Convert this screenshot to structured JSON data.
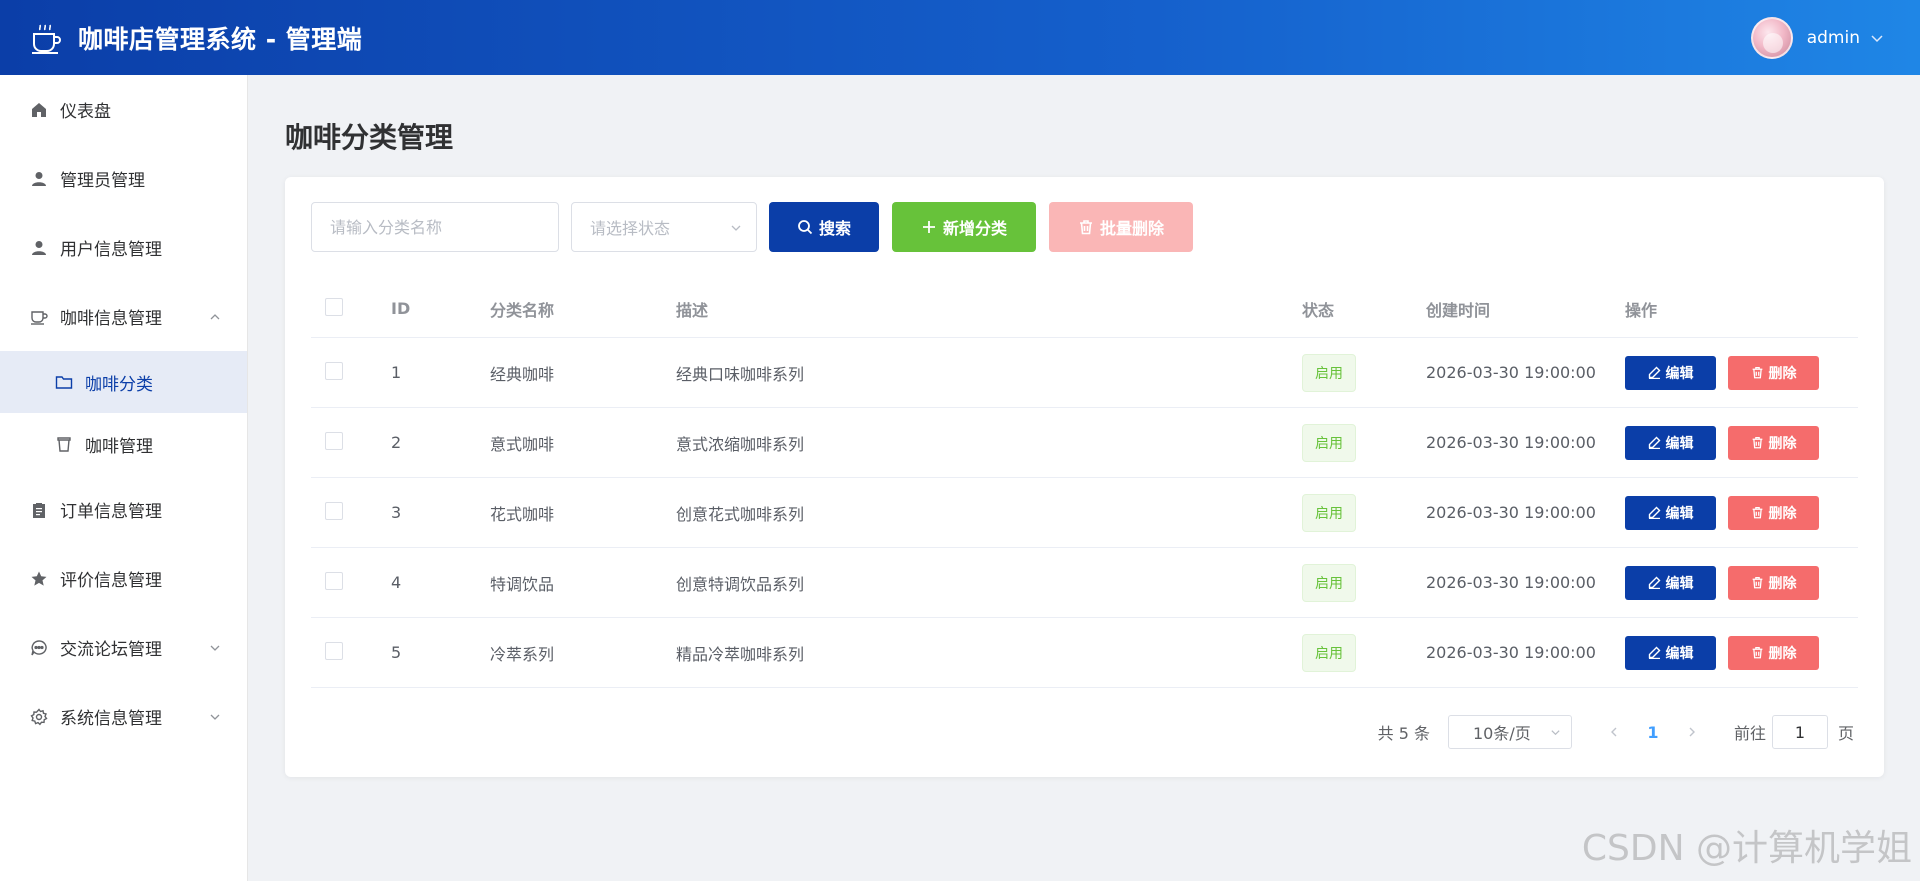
{
  "header": {
    "title": "咖啡店管理系统 - 管理端",
    "username": "admin"
  },
  "sidebar": {
    "items": [
      {
        "label": "仪表盘",
        "icon": "home-icon"
      },
      {
        "label": "管理员管理",
        "icon": "user-icon"
      },
      {
        "label": "用户信息管理",
        "icon": "user-icon"
      },
      {
        "label": "咖啡信息管理",
        "icon": "coffee-cup-icon",
        "expanded": true,
        "children": [
          {
            "label": "咖啡分类",
            "icon": "folder-icon",
            "active": true
          },
          {
            "label": "咖啡管理",
            "icon": "cup-icon"
          }
        ]
      },
      {
        "label": "订单信息管理",
        "icon": "clipboard-icon"
      },
      {
        "label": "评价信息管理",
        "icon": "star-icon"
      },
      {
        "label": "交流论坛管理",
        "icon": "chat-icon"
      },
      {
        "label": "系统信息管理",
        "icon": "gear-icon"
      }
    ]
  },
  "page": {
    "title": "咖啡分类管理"
  },
  "toolbar": {
    "search_placeholder": "请输入分类名称",
    "status_placeholder": "请选择状态",
    "search_label": "搜索",
    "add_label": "新增分类",
    "batch_delete_label": "批量删除"
  },
  "table": {
    "columns": [
      "ID",
      "分类名称",
      "描述",
      "状态",
      "创建时间",
      "操作"
    ],
    "rows": [
      {
        "id": "1",
        "name": "经典咖啡",
        "desc": "经典口味咖啡系列",
        "status": "启用",
        "created": "2026-03-30 19:00:00"
      },
      {
        "id": "2",
        "name": "意式咖啡",
        "desc": "意式浓缩咖啡系列",
        "status": "启用",
        "created": "2026-03-30 19:00:00"
      },
      {
        "id": "3",
        "name": "花式咖啡",
        "desc": "创意花式咖啡系列",
        "status": "启用",
        "created": "2026-03-30 19:00:00"
      },
      {
        "id": "4",
        "name": "特调饮品",
        "desc": "创意特调饮品系列",
        "status": "启用",
        "created": "2026-03-30 19:00:00"
      },
      {
        "id": "5",
        "name": "冷萃系列",
        "desc": "精品冷萃咖啡系列",
        "status": "启用",
        "created": "2026-03-30 19:00:00"
      }
    ],
    "edit_label": "编辑",
    "delete_label": "删除"
  },
  "pagination": {
    "total": "共 5 条",
    "page_size": "10条/页",
    "current_page": "1",
    "goto_label": "前往",
    "goto_value": "1",
    "page_suffix": "页"
  },
  "watermark": "CSDN @计算机学姐",
  "colors": {
    "primary": "#0b3ea8",
    "success": "#67c23a",
    "danger": "#f56c6c",
    "danger_light": "#fab6b6"
  }
}
